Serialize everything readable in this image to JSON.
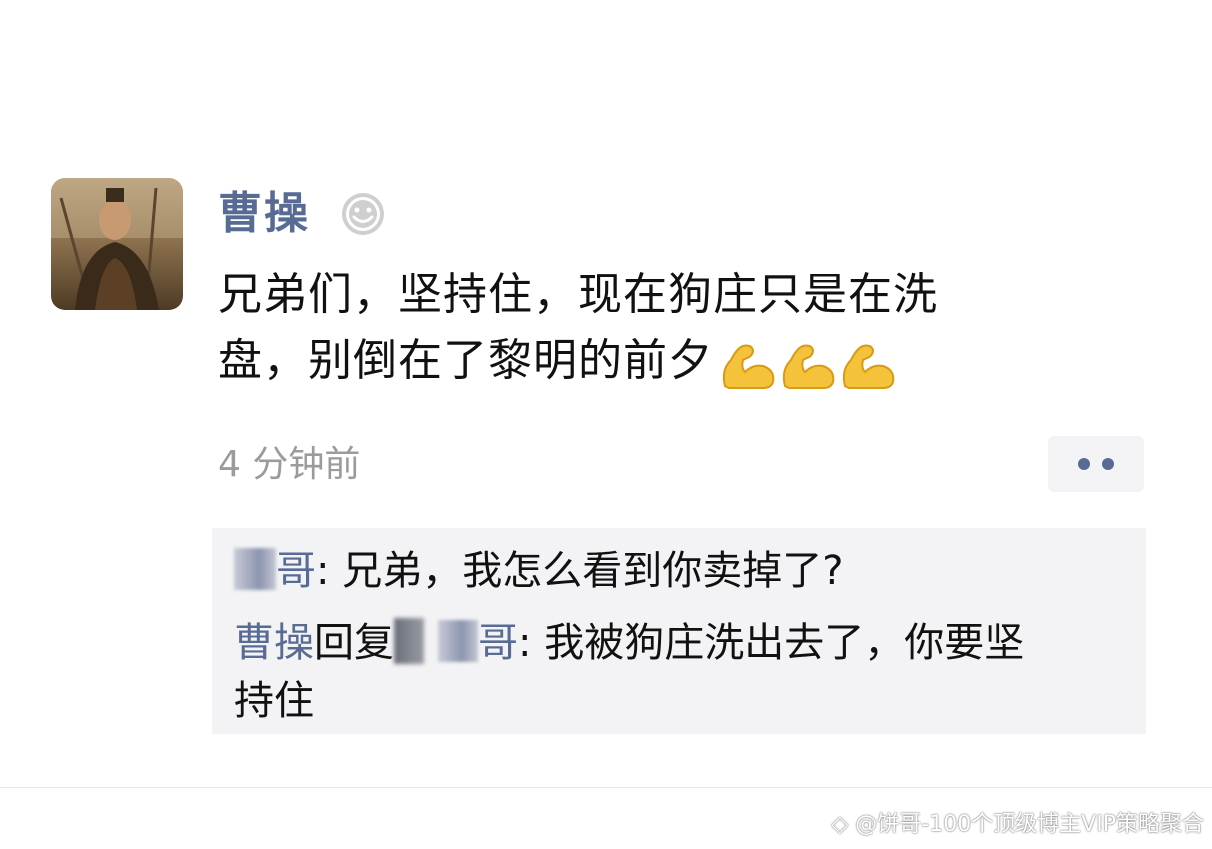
{
  "post": {
    "author": "曹操",
    "text_line1": "兄弟们，坚持住，现在狗庄只是在洗",
    "text_line2": "盘，别倒在了黎明的前夕",
    "time": "4 分钟前",
    "emoji": [
      "flexed-biceps",
      "flexed-biceps",
      "flexed-biceps"
    ]
  },
  "comments": [
    {
      "name_suffix": "哥",
      "separator": ": ",
      "text": "兄弟，我怎么看到你卖掉了?"
    },
    {
      "name": "曹操",
      "reply_word": "回复",
      "reply_to_suffix": "哥",
      "separator": ": ",
      "text_line1": "我被狗庄洗出去了，你要坚",
      "text_line2": "持住"
    }
  ],
  "watermark": "◇ @饼哥-100个顶级博主VIP策略聚合",
  "colors": {
    "name_link": "#576b95",
    "text": "#111111",
    "timestamp": "#9b9b9b",
    "comment_bg": "#f3f3f5"
  }
}
